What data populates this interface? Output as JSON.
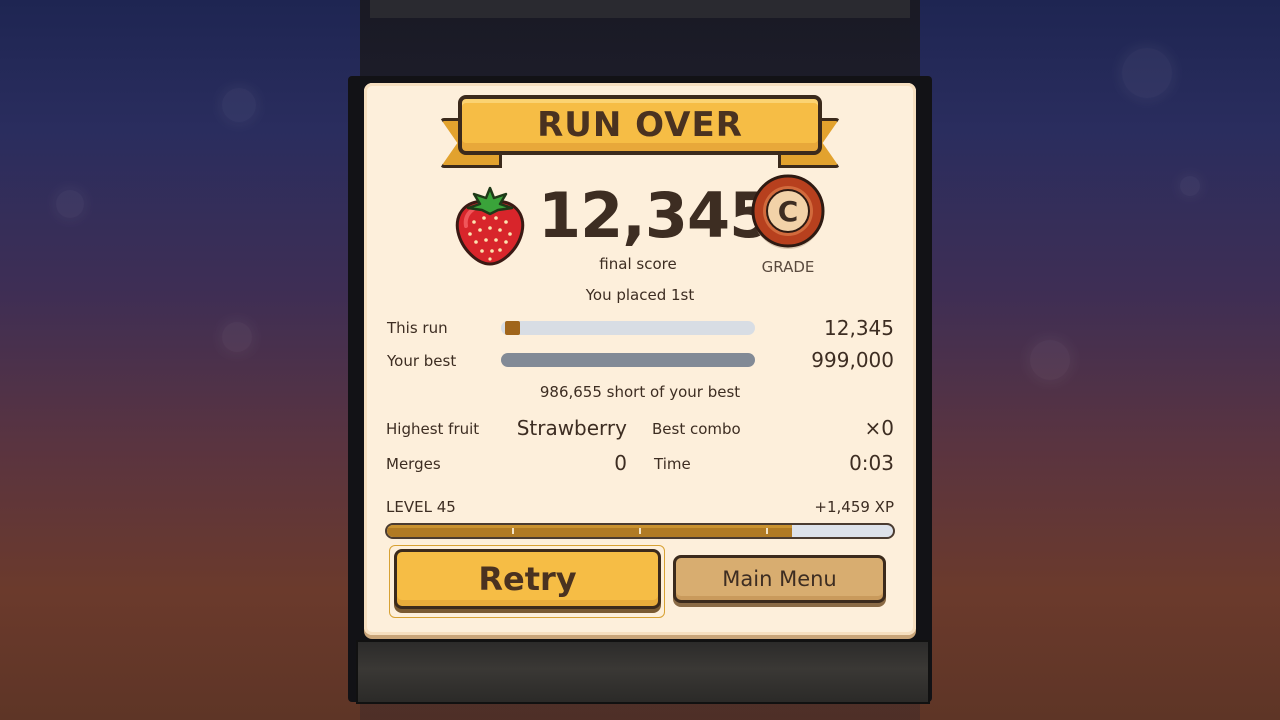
{
  "header": {
    "title": "RUN OVER"
  },
  "score": {
    "value": "12,345",
    "label": "final score",
    "fruit_icon": "strawberry-icon"
  },
  "grade": {
    "letter": "C",
    "label": "GRADE"
  },
  "placement": "You placed 1st",
  "comparison": {
    "this_run": {
      "label": "This run",
      "value": "12,345",
      "fill_fraction": 0.012,
      "color": "#a0651b"
    },
    "your_best": {
      "label": "Your best",
      "value": "999,000",
      "fill_fraction": 1.0,
      "color": "#828a96"
    },
    "short_text": "986,655 short of your best"
  },
  "stats": {
    "highest_fruit": {
      "label": "Highest fruit",
      "value": "Strawberry"
    },
    "best_combo": {
      "label": "Best combo",
      "value": "×0"
    },
    "merges": {
      "label": "Merges",
      "value": "0"
    },
    "time": {
      "label": "Time",
      "value": "0:03"
    }
  },
  "level": {
    "label": "LEVEL 45",
    "xp_gain": "+1,459 XP",
    "progress_fraction": 0.8
  },
  "buttons": {
    "retry": "Retry",
    "main_menu": "Main Menu"
  },
  "colors": {
    "accent": "#f6bd45",
    "panel": "#fdefdb",
    "text": "#3d2d22",
    "outline": "#3b2a1c"
  }
}
